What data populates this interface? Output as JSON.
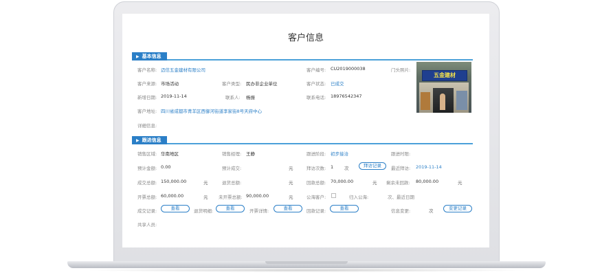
{
  "page": {
    "title": "客户信息"
  },
  "sections": {
    "basic": "基本信息",
    "followup": "跟进信息"
  },
  "basic": {
    "customer_name_label": "客户名称:",
    "customer_name": "迈信五金建材有限公司",
    "customer_id_label": "客户编号:",
    "customer_id": "CU2019000038",
    "storefront_label": "门头照片:",
    "source_label": "客户来源:",
    "source": "市场活动",
    "type_label": "客户类型:",
    "type": "民办非企业单位",
    "status_label": "客户状态:",
    "status": "已成交",
    "added_date_label": "新增日期:",
    "added_date": "2019-11-14",
    "contact_label": "联系人:",
    "contact": "杨振",
    "phone_label": "联系电话:",
    "phone": "18976542347",
    "address_label": "客户地址:",
    "address": "四川省成都市青羊区西御河街道李家街8号天府中心",
    "detail_label": "详细信息:",
    "photo_sign": "五金建材"
  },
  "followup": {
    "region_label": "销售区域:",
    "region": "华南地区",
    "manager_label": "销售经理:",
    "manager": "王静",
    "stage_label": "跟进阶段:",
    "stage": "初步接洽",
    "next_time_label": "跟进时限:",
    "est_amount_label": "预计金额:",
    "est_amount": "0.00",
    "est_deal_label": "预计成交:",
    "unit_yuan": "元",
    "visit_count_label": "拜访次数:",
    "visit_count": "1",
    "unit_times": "次",
    "visit_record_btn": "拜访记录",
    "last_visit_label": "最近拜访:",
    "last_visit": "2019-11-14",
    "deal_total_label": "成交总额:",
    "deal_total": "150,000.00",
    "refund_total_label": "退货总额:",
    "return_total_label": "回款总额:",
    "return_total": "70,000.00",
    "remaining_label": "剩余未回款:",
    "remaining": "80,000.00",
    "invoiced_label": "开票总额:",
    "invoiced": "60,000.00",
    "not_invoiced_label": "未开票总额:",
    "not_invoiced": "90,000.00",
    "public_label": "公海客户:",
    "to_public_label": "归入公海:",
    "recent_date_label": "次、最近日期",
    "deal_record_label": "成交记录:",
    "refund_detail_label": "退货明细:",
    "invoice_detail_label": "开票详情:",
    "payment_record_label": "回款记录:",
    "view_btn": "查看",
    "info_change_label": "信息变更:",
    "change_record_btn": "变更记录",
    "shared_label": "共享人员:"
  }
}
